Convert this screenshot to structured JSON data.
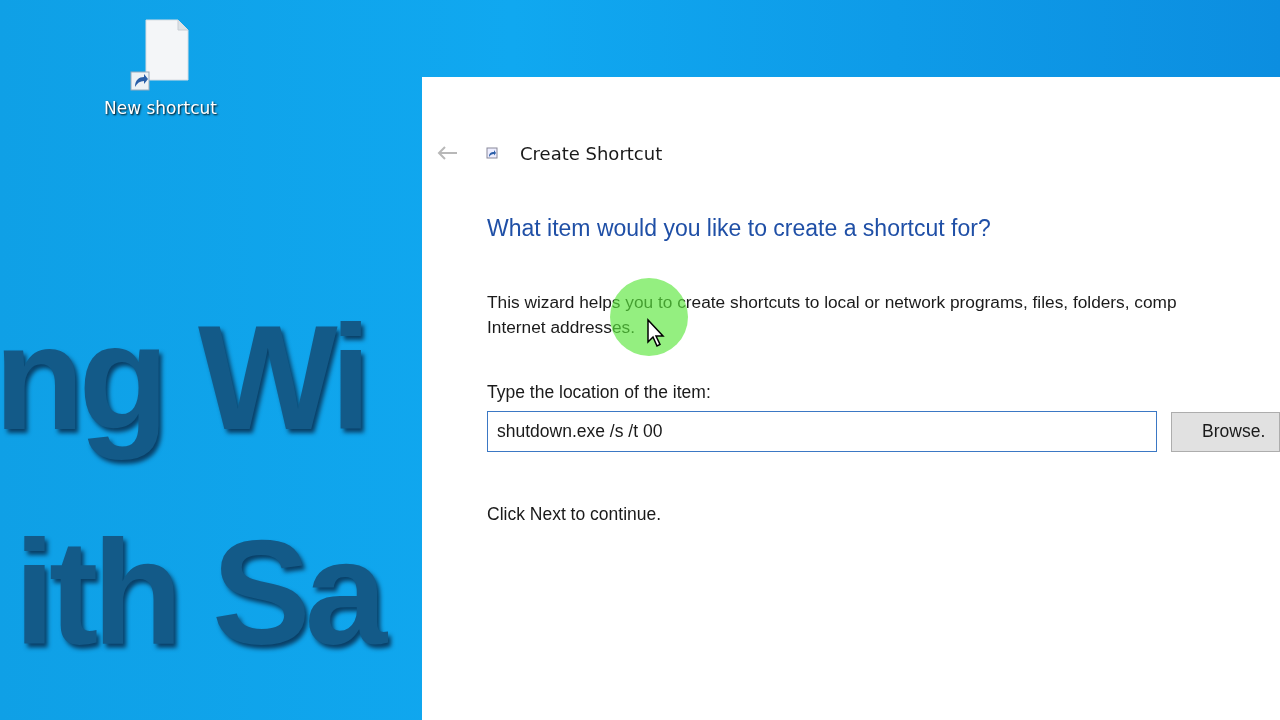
{
  "desktop": {
    "icons": [
      {
        "label": "New shortcut"
      }
    ],
    "wallpaper_text": [
      "ng Wi",
      "ith Sa"
    ]
  },
  "dialog": {
    "title": "Create Shortcut",
    "heading": "What item would you like to create a shortcut for?",
    "description_lines": [
      "This wizard helps you to create shortcuts to local or network programs, files, folders, comp",
      "Internet addresses."
    ],
    "location_label": "Type the location of the item:",
    "location_value": "shutdown.exe /s /t 00",
    "browse_button": "Browse.",
    "footer_text": "Click Next to continue."
  }
}
